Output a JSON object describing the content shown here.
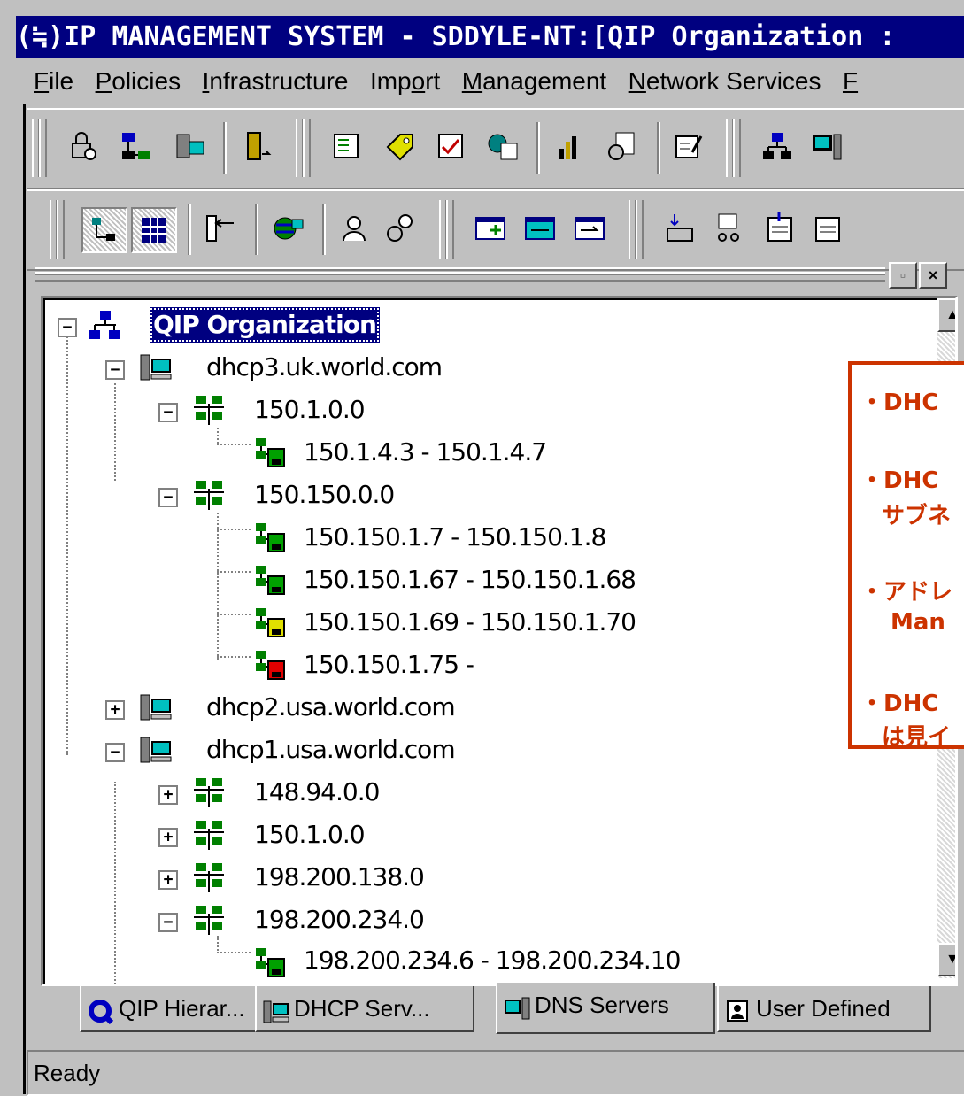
{
  "window": {
    "title": "(≒)IP MANAGEMENT SYSTEM - SDDYLE-NT:[QIP Organization :"
  },
  "menu": [
    {
      "label": "File",
      "u": "F",
      "rest": "ile"
    },
    {
      "label": "Policies",
      "u": "P",
      "rest": "olicies"
    },
    {
      "label": "Infrastructure",
      "u": "I",
      "rest": "nfrastructure"
    },
    {
      "label": "Import",
      "pre": "Imp",
      "u": "o",
      "rest": "rt"
    },
    {
      "label": "Management",
      "u": "M",
      "rest": "anagement"
    },
    {
      "label": "Network Services",
      "u": "N",
      "rest": "etwork Services"
    },
    {
      "label": "F",
      "u": "F",
      "rest": ""
    }
  ],
  "tree": {
    "root": "QIP Organization",
    "server_uk": "dhcp3.uk.world.com",
    "subnet_uk_1": "150.1.0.0",
    "range_uk_1": "150.1.4.3 - 150.1.4.7",
    "subnet_uk_2": "150.150.0.0",
    "range_uk_2a": "150.150.1.7 - 150.150.1.8",
    "range_uk_2b": "150.150.1.67 - 150.150.1.68",
    "range_uk_2c": "150.150.1.69 - 150.150.1.70",
    "range_uk_2d": "150.150.1.75 -",
    "server_usa2": "dhcp2.usa.world.com",
    "server_usa1": "dhcp1.usa.world.com",
    "subnet_usa_1": "148.94.0.0",
    "subnet_usa_2": "150.1.0.0",
    "subnet_usa_3": "198.200.138.0",
    "subnet_usa_4": "198.200.234.0",
    "range_usa_4": "198.200.234.6 - 198.200.234.10"
  },
  "range_colors": {
    "range_uk_1": "#00a000",
    "range_uk_2a": "#00a000",
    "range_uk_2b": "#00a000",
    "range_uk_2c": "#e0e000",
    "range_uk_2d": "#e00000",
    "range_usa_4": "#00a000"
  },
  "callout": {
    "line1": "・DHC",
    "line2": "・DHC",
    "line3": "サブネ",
    "line4": "・アドレ",
    "line5": "Man",
    "line6": "・DHC",
    "line7": "は見イ"
  },
  "tabs": {
    "qip": "QIP Hierar...",
    "dhcp": "DHCP Serv...",
    "dns": "DNS Servers",
    "user": "User Defined"
  },
  "status": {
    "text": "Ready"
  },
  "accent": {
    "titlebar": "#000080",
    "callout_border": "#cc3300"
  }
}
